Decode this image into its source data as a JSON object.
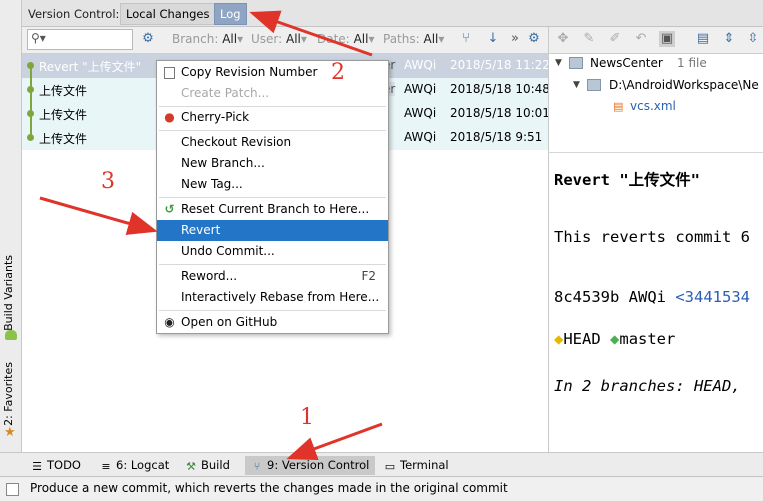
{
  "header": {
    "version_control_label": "Version Control:",
    "tabs": [
      {
        "label": "Local Changes",
        "active": false
      },
      {
        "label": "Log",
        "active": true
      }
    ]
  },
  "toolbar": {
    "filters": [
      {
        "label": "Branch:",
        "value": "All"
      },
      {
        "label": "User:",
        "value": "All"
      },
      {
        "label": "Date:",
        "value": "All"
      },
      {
        "label": "Paths:",
        "value": "All"
      }
    ],
    "search_value": "",
    "icons": [
      "search-icon",
      "gear-icon",
      "merge-icon",
      "arrow-down-icon",
      "more-icon",
      "gear-icon"
    ]
  },
  "commits": [
    {
      "message": "Revert \"上传文件\"",
      "author": "AWQi",
      "date": "2018/5/18 11:22",
      "selected": true
    },
    {
      "message": "上传文件",
      "author": "AWQi",
      "date": "2018/5/18 10:48",
      "selected": false
    },
    {
      "message": "上传文件",
      "author": "AWQi",
      "date": "2018/5/18 10:01",
      "selected": false
    },
    {
      "message": "上传文件",
      "author": "AWQi",
      "date": "2018/5/18 9:51",
      "selected": false
    }
  ],
  "partial_tags": {
    "row0": "er",
    "row1": "er"
  },
  "context_menu": {
    "items": [
      {
        "label": "Copy Revision Number",
        "icon": "copy-icon",
        "disabled": false,
        "highlighted": false
      },
      {
        "label": "Create Patch...",
        "icon": "",
        "disabled": true,
        "highlighted": false
      },
      {
        "label": "Cherry-Pick",
        "icon": "cherry-icon",
        "disabled": false,
        "highlighted": false
      },
      {
        "label": "Checkout Revision",
        "icon": "",
        "disabled": false,
        "highlighted": false
      },
      {
        "label": "New Branch...",
        "icon": "",
        "disabled": false,
        "highlighted": false
      },
      {
        "label": "New Tag...",
        "icon": "",
        "disabled": false,
        "highlighted": false
      },
      {
        "label": "Reset Current Branch to Here...",
        "icon": "reset-icon",
        "disabled": false,
        "highlighted": false
      },
      {
        "label": "Revert",
        "icon": "",
        "disabled": false,
        "highlighted": true
      },
      {
        "label": "Undo Commit...",
        "icon": "",
        "disabled": false,
        "highlighted": false
      },
      {
        "label": "Reword...",
        "icon": "",
        "shortcut": "F2",
        "disabled": false,
        "highlighted": false
      },
      {
        "label": "Interactively Rebase from Here...",
        "icon": "",
        "disabled": false,
        "highlighted": false
      },
      {
        "label": "Open on GitHub",
        "icon": "github-icon",
        "disabled": false,
        "highlighted": false
      }
    ]
  },
  "changes_tree": {
    "root": "NewsCenter",
    "root_count": "1 file",
    "path": "D:\\AndroidWorkspace\\Ne",
    "file": "vcs.xml"
  },
  "details": {
    "title": "Revert \"上传文件\"",
    "body": "This reverts commit 6",
    "hash": "8c4539b",
    "author": "AWQi",
    "link": "<3441534",
    "tag_head": "HEAD",
    "tag_master": "master",
    "branches": "In 2 branches: HEAD,"
  },
  "left_strip": {
    "build_variants": "Build Variants",
    "favorites": "2: Favorites"
  },
  "bottom_tabs": [
    {
      "label": "TODO",
      "icon": "todo-icon",
      "active": false
    },
    {
      "label": "6: Logcat",
      "icon": "logcat-icon",
      "active": false
    },
    {
      "label": "Build",
      "icon": "build-icon",
      "active": false
    },
    {
      "label": "9: Version Control",
      "icon": "vcs-icon",
      "active": true
    },
    {
      "label": "Terminal",
      "icon": "terminal-icon",
      "active": false
    }
  ],
  "status": {
    "text": "Produce a new commit, which reverts the changes made in the original commit"
  },
  "annotations": [
    "1",
    "2",
    "3"
  ],
  "colors": {
    "accent": "#2375c8",
    "annotation": "#e0342a",
    "graph": "#7fa63c",
    "row_bg": "#e9f6f8",
    "selected_row": "#c9d2de"
  }
}
